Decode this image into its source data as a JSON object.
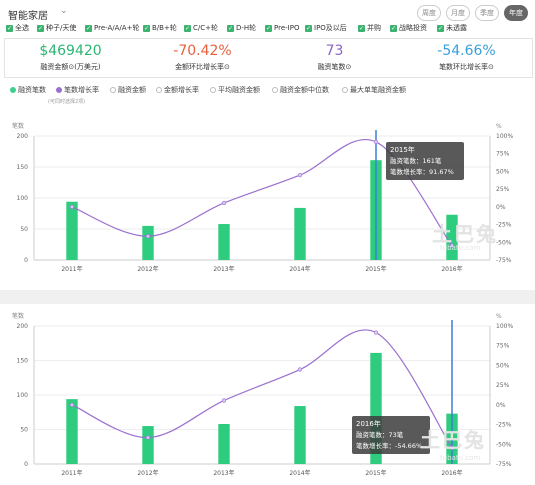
{
  "header": {
    "title": "智能家居",
    "periods": [
      "周度",
      "月度",
      "季度",
      "年度"
    ],
    "active_period": "年度"
  },
  "filters": [
    "全选",
    "种子/天使",
    "Pre-A/A/A+轮",
    "B/B+轮",
    "C/C+轮",
    "D-H轮",
    "Pre-IPO",
    "IPO及以后",
    "并购",
    "战略投资",
    "未透露"
  ],
  "kpis": [
    {
      "value": "$469420",
      "label": "融资金额⊙(万美元)",
      "color": "#2ab673"
    },
    {
      "value": "-70.42%",
      "label": "金额环比增长率⊙",
      "color": "#e8613c"
    },
    {
      "value": "73",
      "label": "融资笔数⊙",
      "color": "#8a64c9"
    },
    {
      "value": "-54.66%",
      "label": "笔数环比增长率⊙",
      "color": "#3aa0d8"
    }
  ],
  "legend": [
    {
      "label": "融资笔数",
      "color": "#3ecf8e",
      "active": true
    },
    {
      "label": "笔数增长率",
      "color": "#9b6fd0",
      "active": true
    },
    {
      "label": "融资金额",
      "color": "#bbbbbb",
      "active": false
    },
    {
      "label": "金额增长率",
      "color": "#bbbbbb",
      "active": false
    },
    {
      "label": "平均融资金额",
      "color": "#bbbbbb",
      "active": false
    },
    {
      "label": "融资金额中位数",
      "color": "#bbbbbb",
      "active": false
    },
    {
      "label": "最大单笔融资金额",
      "color": "#bbbbbb",
      "active": false
    }
  ],
  "note": "(可同时选择2项)",
  "colors": {
    "bar": "#2ecc7e",
    "line": "#9b6fd0",
    "highlight": "#3b7fd6"
  },
  "chart_data": [
    {
      "type": "bar",
      "categories": [
        "2011年",
        "2012年",
        "2013年",
        "2014年",
        "2015年",
        "2016年"
      ],
      "series": [
        {
          "name": "融资笔数",
          "type": "bar",
          "axis": "left",
          "values": [
            94,
            55,
            58,
            84,
            161,
            73
          ]
        },
        {
          "name": "笔数增长率",
          "type": "line",
          "axis": "right",
          "values": [
            0,
            -41.5,
            5.5,
            44.8,
            91.67,
            -54.66
          ]
        }
      ],
      "left_axis_label": "笔数",
      "right_axis_label": "%",
      "yticks_left": [
        0,
        50,
        100,
        150,
        200
      ],
      "yticks_right": [
        "100%",
        "75%",
        "50%",
        "25%",
        "0%",
        "-25%",
        "-50%",
        "-75%"
      ],
      "ylim_left": [
        0,
        200
      ],
      "ylim_right": [
        -75,
        100
      ],
      "tooltip": {
        "title": "2015年",
        "line1": "融资笔数：161笔",
        "line2": "笔数增长率：91.67%"
      },
      "highlight_index": 4
    },
    {
      "type": "bar",
      "categories": [
        "2011年",
        "2012年",
        "2013年",
        "2014年",
        "2015年",
        "2016年"
      ],
      "series": [
        {
          "name": "融资笔数",
          "type": "bar",
          "axis": "left",
          "values": [
            94,
            55,
            58,
            84,
            161,
            73
          ]
        },
        {
          "name": "笔数增长率",
          "type": "line",
          "axis": "right",
          "values": [
            0,
            -41.5,
            5.5,
            44.8,
            91.67,
            -54.66
          ]
        }
      ],
      "left_axis_label": "笔数",
      "right_axis_label": "%",
      "yticks_left": [
        0,
        50,
        100,
        150,
        200
      ],
      "yticks_right": [
        "100%",
        "75%",
        "50%",
        "25%",
        "0%",
        "-25%",
        "-50%",
        "-75%"
      ],
      "ylim_left": [
        0,
        200
      ],
      "ylim_right": [
        -75,
        100
      ],
      "tooltip": {
        "title": "2016年",
        "line1": "融资笔数：73笔",
        "line2": "笔数增长率：-54.66%"
      },
      "highlight_index": 5
    }
  ],
  "watermark": {
    "main": "土巴兔",
    "sub": "tubatu.com"
  }
}
